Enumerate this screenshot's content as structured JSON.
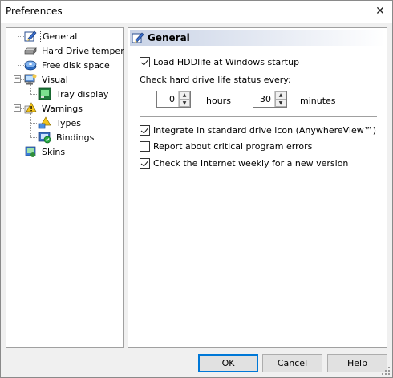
{
  "window": {
    "title": "Preferences",
    "close_symbol": "✕"
  },
  "tree": {
    "items": [
      {
        "label": "General",
        "icon": "settings-pen-icon"
      },
      {
        "label": "Hard Drive temper",
        "icon": "hard-drive-icon"
      },
      {
        "label": "Free disk space",
        "icon": "disk-icon"
      },
      {
        "label": "Visual",
        "icon": "monitor-icon"
      },
      {
        "label": "Tray display",
        "icon": "tray-icon"
      },
      {
        "label": "Warnings",
        "icon": "warning-icon"
      },
      {
        "label": "Types",
        "icon": "types-icon"
      },
      {
        "label": "Bindings",
        "icon": "bindings-icon"
      },
      {
        "label": "Skins",
        "icon": "skins-icon"
      }
    ],
    "expander_symbol": "−"
  },
  "panel": {
    "header": "General",
    "load_startup": {
      "label": "Load HDDlife at Windows startup",
      "checked": true
    },
    "check_status_label": "Check hard drive life status every:",
    "hours_value": "0",
    "hours_label": "hours",
    "minutes_value": "30",
    "minutes_label": "minutes",
    "integrate": {
      "label": "Integrate in standard drive icon (AnywhereView™)",
      "checked": true
    },
    "report": {
      "label": "Report about critical program errors",
      "checked": false
    },
    "check_internet": {
      "label": "Check the Internet weekly for a new version",
      "checked": true
    }
  },
  "buttons": {
    "ok": "OK",
    "cancel": "Cancel",
    "help": "Help"
  },
  "colors": {
    "accent": "#0078d7",
    "header_gradient": "#c9d3e6"
  }
}
